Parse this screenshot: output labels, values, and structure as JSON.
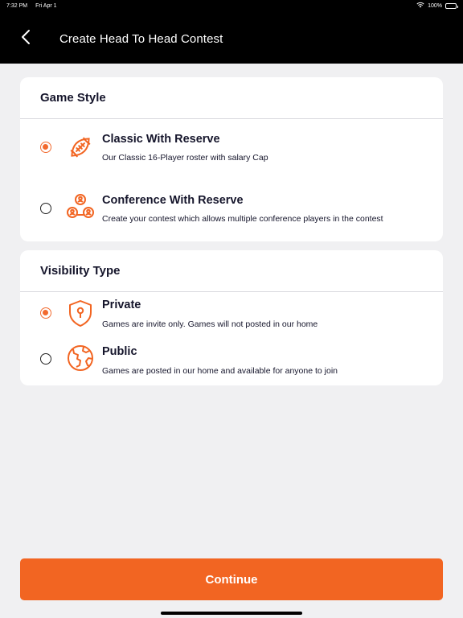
{
  "status_bar": {
    "time": "7:32 PM",
    "date": "Fri Apr 1",
    "battery": "100%"
  },
  "nav": {
    "title": "Create Head To Head Contest",
    "back_icon": "chevron-left-icon"
  },
  "game_style": {
    "header": "Game Style",
    "options": [
      {
        "title": "Classic With Reserve",
        "description": "Our Classic 16-Player roster with salary Cap",
        "icon": "football-icon",
        "selected": true
      },
      {
        "title": "Conference With Reserve",
        "description": "Create your contest which allows multiple conference players in the contest",
        "icon": "group-network-icon",
        "selected": false
      }
    ]
  },
  "visibility_type": {
    "header": "Visibility Type",
    "options": [
      {
        "title": "Private",
        "description": "Games are invite only. Games will not posted in our home",
        "icon": "shield-lock-icon",
        "selected": true
      },
      {
        "title": "Public",
        "description": "Games are posted in our home and available for anyone to join",
        "icon": "globe-icon",
        "selected": false
      }
    ]
  },
  "continue_label": "Continue",
  "colors": {
    "accent": "#f26522",
    "nav_background": "#000000",
    "page_background": "#f0f0f2"
  }
}
